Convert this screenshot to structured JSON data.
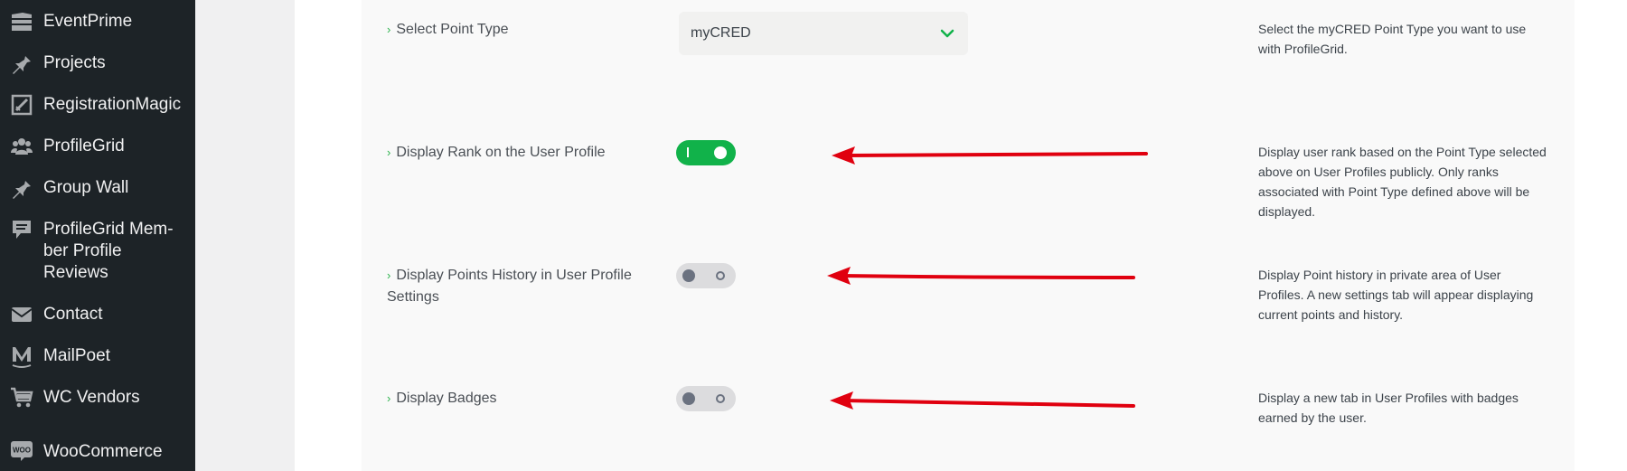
{
  "sidebar": {
    "items": [
      {
        "label": "EventPrime",
        "icon": "eventprime-icon"
      },
      {
        "label": "Projects",
        "icon": "pin-icon"
      },
      {
        "label": "RegistrationMagic",
        "icon": "form-icon"
      },
      {
        "label": "ProfileGrid",
        "icon": "users-icon"
      },
      {
        "label": "Group Wall",
        "icon": "pin-icon"
      },
      {
        "label": "ProfileGrid Mem-\nber Profile\nReviews",
        "icon": "comment-icon"
      },
      {
        "label": "Contact",
        "icon": "envelope-icon"
      },
      {
        "label": "MailPoet",
        "icon": "mailpoet-icon"
      },
      {
        "label": "WC Vendors",
        "icon": "cart-icon"
      },
      {
        "label": "WooCommerce",
        "icon": "woo-icon"
      }
    ]
  },
  "settings": {
    "point_type": {
      "label": "Select Point Type",
      "value": "myCRED",
      "description": "Select the myCRED Point Type you want to use with ProfileGrid."
    },
    "display_rank": {
      "label": "Display Rank on the User Profile",
      "enabled": true,
      "description": "Display user rank based on the Point Type selected above on User Profiles publicly. Only ranks associated with Point Type defined above will be displayed."
    },
    "display_points_history": {
      "label": "Display Points History in User Profile Settings",
      "enabled": false,
      "description": "Display Point history in private area of User Profiles. A new settings tab will appear displaying current points and history."
    },
    "display_badges": {
      "label": "Display Badges",
      "enabled": false,
      "description": "Display a new tab in User Profiles with badges earned by the user."
    }
  },
  "colors": {
    "sidebar_bg": "#1d2327",
    "toggle_on": "#11b24a",
    "accent": "#2bb24c",
    "annotation_arrow": "#e0000f"
  }
}
